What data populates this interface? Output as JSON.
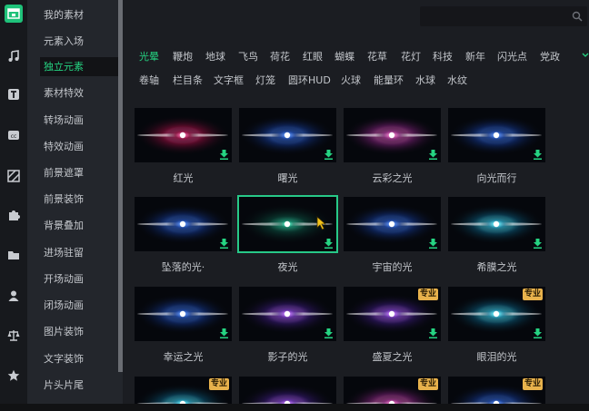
{
  "rail": {
    "icons": [
      "media-icon",
      "music-icon",
      "text-icon",
      "subtitle-icon",
      "filter-icon",
      "plugin-icon",
      "folder-icon",
      "person-icon",
      "balance-icon",
      "star-icon"
    ]
  },
  "categories": [
    "我的素材",
    "元素入场",
    "独立元素",
    "素材特效",
    "转场动画",
    "特效动画",
    "前景遮罩",
    "前景装饰",
    "背景叠加",
    "进场驻留",
    "开场动画",
    "闭场动画",
    "图片装饰",
    "文字装饰",
    "片头片尾"
  ],
  "active_category": "独立元素",
  "search": {
    "placeholder": ""
  },
  "tabs_row1": [
    "光晕",
    "鞭炮",
    "地球",
    "飞鸟",
    "荷花",
    "红眼",
    "蝴蝶",
    "花草",
    "花灯",
    "科技",
    "新年",
    "闪光点",
    "党政"
  ],
  "tabs_row2": [
    "卷轴",
    "栏目条",
    "文字框",
    "灯笼",
    "圆环HUD",
    "火球",
    "能量环",
    "水球",
    "水纹"
  ],
  "active_tab": "光晕",
  "items": [
    {
      "label": "红光",
      "pro": false,
      "selected": false
    },
    {
      "label": "曙光",
      "pro": false,
      "selected": false
    },
    {
      "label": "云彩之光",
      "pro": false,
      "selected": false
    },
    {
      "label": "向光而行",
      "pro": false,
      "selected": false
    },
    {
      "label": "坠落的光·",
      "pro": false,
      "selected": false
    },
    {
      "label": "夜光",
      "pro": false,
      "selected": true
    },
    {
      "label": "宇宙的光",
      "pro": false,
      "selected": false
    },
    {
      "label": "希膜之光",
      "pro": false,
      "selected": false
    },
    {
      "label": "幸运之光",
      "pro": false,
      "selected": false
    },
    {
      "label": "影子的光",
      "pro": false,
      "selected": false
    },
    {
      "label": "盛夏之光",
      "pro": true,
      "selected": false
    },
    {
      "label": "眼泪的光",
      "pro": true,
      "selected": false
    },
    {
      "label": "",
      "pro": true,
      "selected": false
    },
    {
      "label": "",
      "pro": false,
      "selected": false
    },
    {
      "label": "",
      "pro": true,
      "selected": false
    },
    {
      "label": "",
      "pro": true,
      "selected": false
    }
  ],
  "pro_badge": "专业",
  "colors": {
    "accent": "#25d482",
    "pro": "#e8b24c",
    "panel": "#23262c",
    "bg": "#1b1d22"
  }
}
